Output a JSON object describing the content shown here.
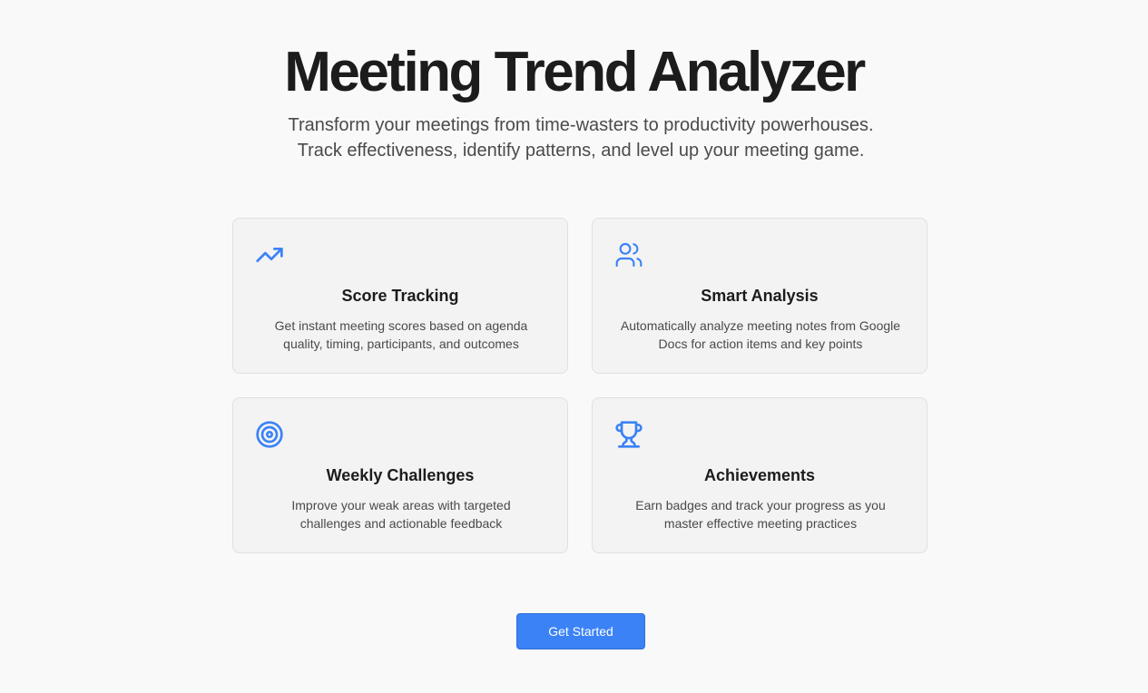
{
  "hero": {
    "title": "Meeting Trend Analyzer",
    "subtitle": "Transform your meetings from time-wasters to productivity powerhouses. Track effectiveness, identify patterns, and level up your meeting game."
  },
  "features": [
    {
      "icon": "trending-up-icon",
      "title": "Score Tracking",
      "description": "Get instant meeting scores based on agenda quality, timing, participants, and outcomes"
    },
    {
      "icon": "users-icon",
      "title": "Smart Analysis",
      "description": "Automatically analyze meeting notes from Google Docs for action items and key points"
    },
    {
      "icon": "target-icon",
      "title": "Weekly Challenges",
      "description": "Improve your weak areas with targeted challenges and actionable feedback"
    },
    {
      "icon": "trophy-icon",
      "title": "Achievements",
      "description": "Earn badges and track your progress as you master effective meeting practices"
    }
  ],
  "cta": {
    "label": "Get Started"
  },
  "colors": {
    "accent": "#3b82f6",
    "background": "#f9f9f9",
    "card_background": "#f3f3f3",
    "title_text": "#1c1c1c",
    "body_text": "#4a4a4a"
  }
}
